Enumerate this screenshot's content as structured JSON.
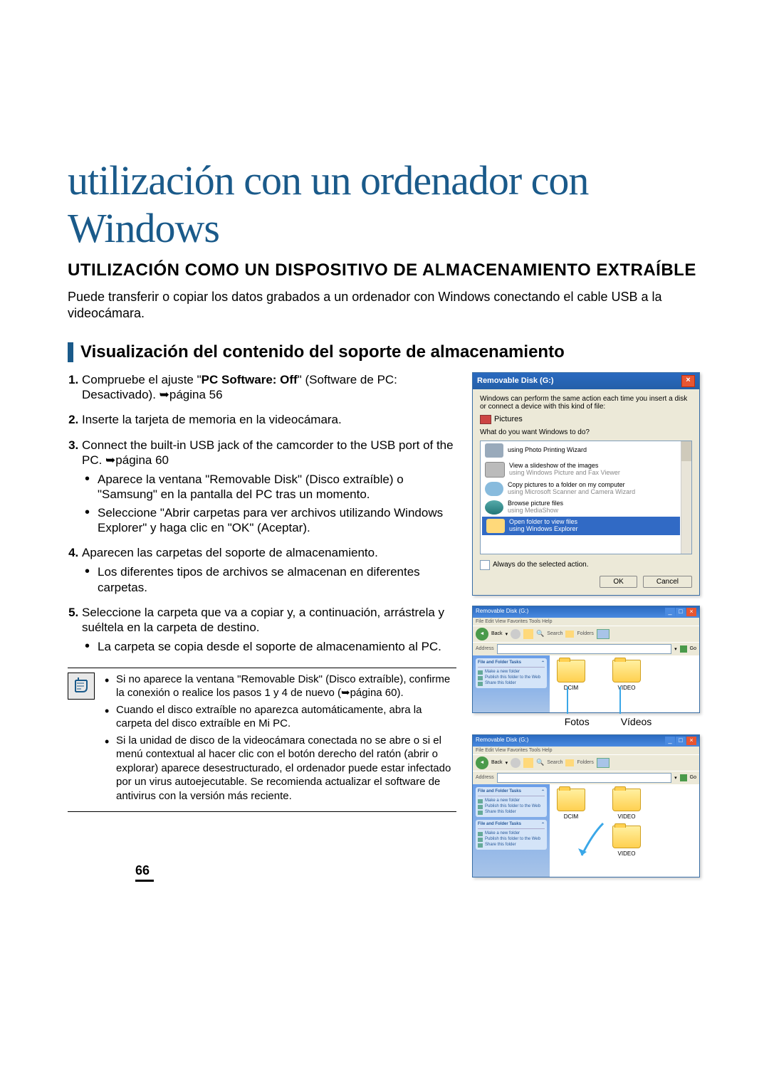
{
  "page_number": "66",
  "title": "utilización con un ordenador con Windows",
  "section_heading": "UTILIZACIÓN COMO UN DISPOSITIVO DE ALMACENAMIENTO EXTRAÍBLE",
  "intro": "Puede transferir o copiar los datos grabados a un ordenador con Windows conectando el cable USB a la videocámara.",
  "subsection": "Visualización del contenido del soporte de almacenamiento",
  "steps": {
    "s1_pre": "Compruebe el ajuste \"",
    "s1_bold": "PC Software: Off",
    "s1_post": "\" (Software de PC: Desactivado). ➥página 56",
    "s2": "Inserte la tarjeta de memoria en la videocámara.",
    "s3": "Connect the built-in USB jack of the camcorder to the USB port of the PC. ➥página 60",
    "s3_b1": "Aparece la ventana \"Removable Disk\" (Disco extraíble) o \"Samsung\" en la pantalla del PC tras un momento.",
    "s3_b2": "Seleccione \"Abrir carpetas para ver archivos utilizando Windows Explorer\" y haga clic en \"OK\" (Aceptar).",
    "s4": "Aparecen las carpetas del soporte de almacenamiento.",
    "s4_b1": "Los diferentes tipos de archivos se almacenan en diferentes carpetas.",
    "s5": "Seleccione la carpeta que va a copiar y, a continuación, arrástrela y suéltela en la carpeta de destino.",
    "s5_b1": "La carpeta se copia desde el soporte de almacenamiento al PC."
  },
  "notes": {
    "n1": "Si no aparece la ventana \"Removable Disk\" (Disco extraíble), confirme la conexión o realice los pasos 1 y 4 de nuevo (➥página 60).",
    "n2": "Cuando el disco extraíble no aparezca automáticamente, abra la carpeta del disco extraíble en Mi PC.",
    "n3": "Si la unidad de disco de la videocámara conectada no se abre o si el menú contextual al hacer clic con el botón derecho del ratón (abrir o explorar) aparece desestructurado, el ordenador puede estar infectado por un virus autoejecutable. Se recomienda actualizar el software de antivirus con la versión más reciente."
  },
  "dialog": {
    "title": "Removable Disk (G:)",
    "intro": "Windows can perform the same action each time you insert a disk or connect a device with this kind of file:",
    "pictures": "Pictures",
    "prompt": "What do you want Windows to do?",
    "items": {
      "i0": "using Photo Printing Wizard",
      "i1a": "View a slideshow of the images",
      "i1b": "using Windows Picture and Fax Viewer",
      "i2a": "Copy pictures to a folder on my computer",
      "i2b": "using Microsoft Scanner and Camera Wizard",
      "i3a": "Browse picture files",
      "i3b": "using MediaShow",
      "i4a": "Open folder to view files",
      "i4b": "using Windows Explorer"
    },
    "always": "Always do the selected action.",
    "ok": "OK",
    "cancel": "Cancel"
  },
  "explorer": {
    "title": "Removable Disk (G:)",
    "menu": "File  Edit  View  Favorites  Tools  Help",
    "back": "Back",
    "search": "Search",
    "folders_lbl": "Folders",
    "go": "Go",
    "address_lbl": "Address",
    "panel_h": "File and Folder Tasks",
    "task1": "Make a new folder",
    "task2": "Publish this folder to the Web",
    "task3": "Share this folder",
    "folder1": "DCIM",
    "folder2": "VIDEO",
    "label_photos": "Fotos",
    "label_videos": "Vídeos"
  }
}
